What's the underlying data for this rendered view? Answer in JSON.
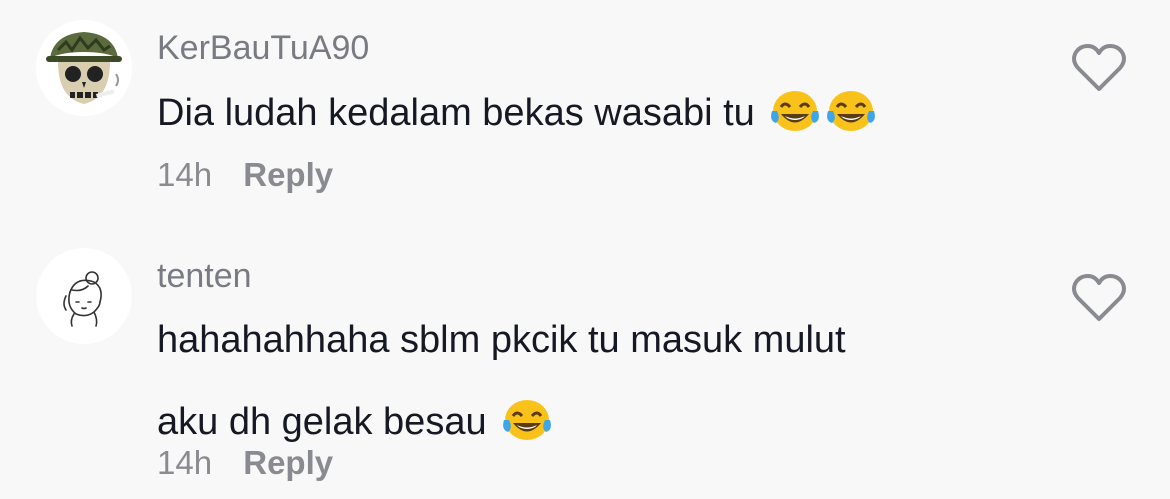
{
  "comments": [
    {
      "username": "KerBauTuA90",
      "text": "Dia ludah kedalam bekas wasabi tu",
      "emojis": [
        "tears-of-joy-emoji",
        "tears-of-joy-emoji"
      ],
      "time": "14h",
      "reply_label": "Reply",
      "avatar": "skull-bucket-hat-avatar",
      "like_icon": "heart-outline-icon"
    },
    {
      "username": "tenten",
      "text_line1": "hahahahhaha sblm pkcik tu masuk mulut",
      "text_line2": "aku dh gelak besau",
      "emojis": [
        "tears-of-joy-emoji"
      ],
      "time": "14h",
      "reply_label": "Reply",
      "avatar": "sketch-girl-avatar",
      "like_icon": "heart-outline-icon"
    }
  ],
  "colors": {
    "background": "#f8f8f8",
    "text": "#161823",
    "secondary": "#8a8b91",
    "emoji_face": "#f9c21b"
  }
}
